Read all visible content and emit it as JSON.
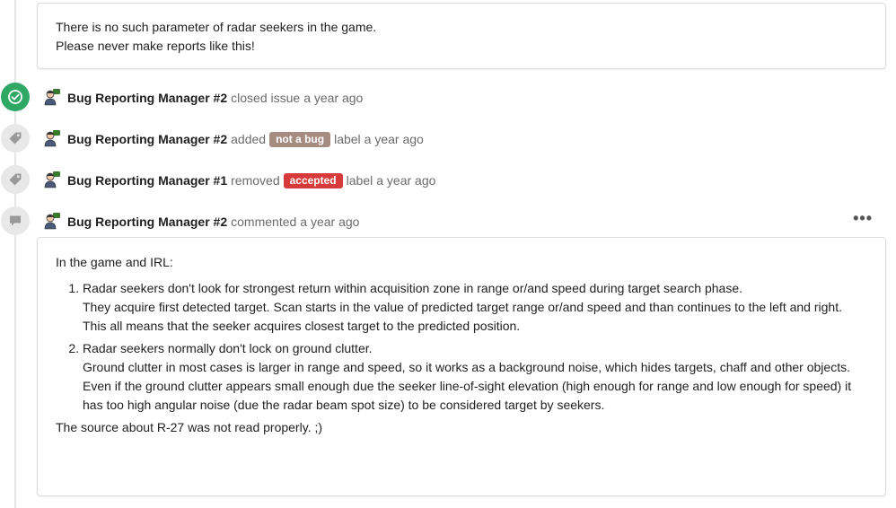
{
  "top_comment": {
    "lines": [
      "There is no such parameter of radar seekers in the game.",
      "Please never make reports like this!"
    ]
  },
  "events": [
    {
      "icon": "check-circle-icon",
      "icon_color": "#2fa865",
      "author": "Bug Reporting Manager #2",
      "action": "closed issue",
      "label": null,
      "suffix": "",
      "time": "a year ago"
    },
    {
      "icon": "tag-icon",
      "icon_color": "#e8e8e8",
      "author": "Bug Reporting Manager #2",
      "action": "added",
      "label": "not a bug",
      "label_color": "#a58b80",
      "suffix": "label",
      "time": "a year ago"
    },
    {
      "icon": "tag-icon",
      "icon_color": "#e8e8e8",
      "author": "Bug Reporting Manager #1",
      "action": "removed",
      "label": "accepted",
      "label_color": "#d63a3a",
      "suffix": "label",
      "time": "a year ago"
    },
    {
      "icon": "comment-icon",
      "icon_color": "#e8e8e8",
      "author": "Bug Reporting Manager #2",
      "action": "commented",
      "label": null,
      "suffix": "",
      "time": "a year ago"
    }
  ],
  "bottom_comment": {
    "intro": "In the game and IRL:",
    "items": [
      {
        "lines": [
          "Radar seekers don't look for strongest return within acquisition zone in range or/and speed during target search phase.",
          "They acquire first detected target. Scan starts in the value of predicted target range or/and speed and than continues to the left and right.",
          "This all means that the seeker acquires closest target to the predicted position."
        ]
      },
      {
        "lines": [
          "Radar seekers normally don't lock on ground clutter.",
          "Ground clutter in most cases is larger in range and speed, so it works as a background noise, which hides targets, chaff and other objects.",
          "Even if the ground clutter appears small enough due the seeker line-of-sight elevation (high enough for range and low enough for speed) it has too high angular noise (due the radar beam spot size) to be considered target by seekers."
        ]
      }
    ],
    "outro": "The source about R-27 was not read properly. ;)"
  },
  "more_menu_glyph": "•••"
}
